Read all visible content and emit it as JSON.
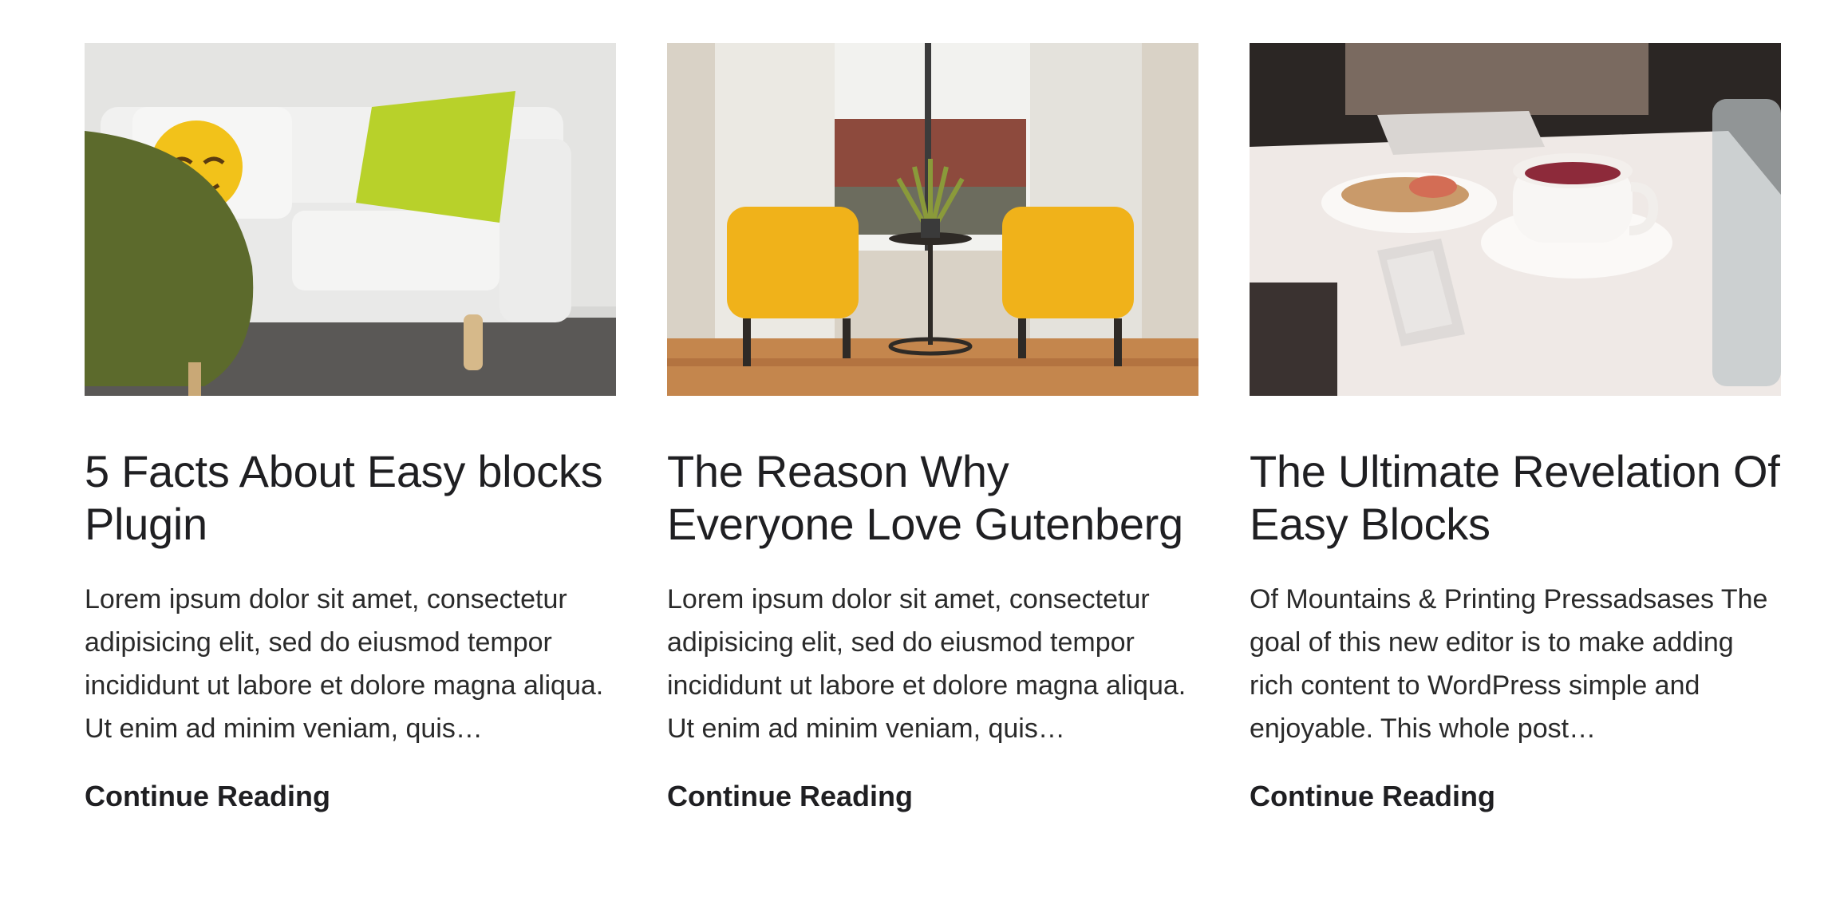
{
  "posts": [
    {
      "title": "5 Facts About Easy blocks Plugin",
      "excerpt": "Lorem ipsum dolor sit amet, consectetur adipisicing elit, sed do eiusmod tempor incididunt ut labore et dolore magna aliqua. Ut enim ad minim veniam, quis…",
      "link_label": "Continue Reading",
      "image_subject": "living-room-sofa-photo"
    },
    {
      "title": "The Reason Why Everyone Love Gutenberg",
      "excerpt": "Lorem ipsum dolor sit amet, consectetur adipisicing elit, sed do eiusmod tempor incididunt ut labore et dolore magna aliqua. Ut enim ad minim veniam, quis…",
      "link_label": "Continue Reading",
      "image_subject": "yellow-chairs-window-photo"
    },
    {
      "title": "The Ultimate Revelation Of Easy Blocks",
      "excerpt": "Of Mountains & Printing Pressadsases The goal of this new editor is to make adding rich content to WordPress simple and enjoyable. This whole post…",
      "link_label": "Continue Reading",
      "image_subject": "coffee-table-breakfast-photo"
    }
  ],
  "colors": {
    "text": "#1f1f22",
    "background": "#ffffff"
  }
}
